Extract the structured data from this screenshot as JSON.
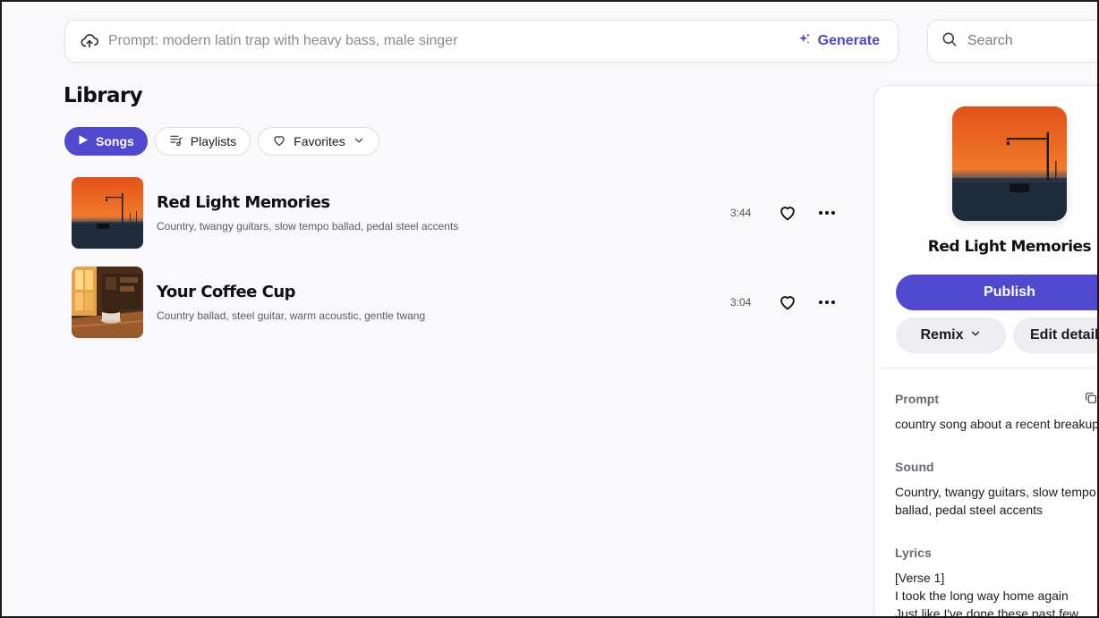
{
  "prompt_bar": {
    "placeholder": "Prompt: modern latin trap with heavy bass, male singer",
    "generate_label": "Generate",
    "accent_color": "#4f46c7"
  },
  "search": {
    "placeholder": "Search"
  },
  "library": {
    "title": "Library",
    "filters": [
      {
        "label": "Songs",
        "icon": "play-icon",
        "active": true
      },
      {
        "label": "Playlists",
        "icon": "playlist-icon",
        "active": false
      },
      {
        "label": "Favorites",
        "icon": "heart-icon",
        "active": false,
        "dropdown": true
      }
    ],
    "songs": [
      {
        "title": "Red Light Memories",
        "tags": "Country, twangy guitars, slow tempo ballad, pedal steel accents",
        "duration": "3:44",
        "cover": "sunset-intersection"
      },
      {
        "title": "Your Coffee Cup",
        "tags": "Country ballad, steel guitar, warm acoustic, gentle twang",
        "duration": "3:04",
        "cover": "coffee-table-window"
      }
    ]
  },
  "detail": {
    "title": "Red Light Memories",
    "publish_label": "Publish",
    "remix_label": "Remix",
    "edit_label": "Edit details",
    "prompt_label": "Prompt",
    "prompt_text": "country song about a recent breakup",
    "sound_label": "Sound",
    "sound_line1": "Country, twangy guitars, slow tempo",
    "sound_line2": "ballad, pedal steel accents",
    "lyrics_label": "Lyrics",
    "lyrics_lines": [
      "[Verse 1]",
      "I took the long way home again",
      "Just like I've done these past few"
    ]
  },
  "colors": {
    "primary": "#5048cf",
    "background": "#f9f9fb"
  }
}
